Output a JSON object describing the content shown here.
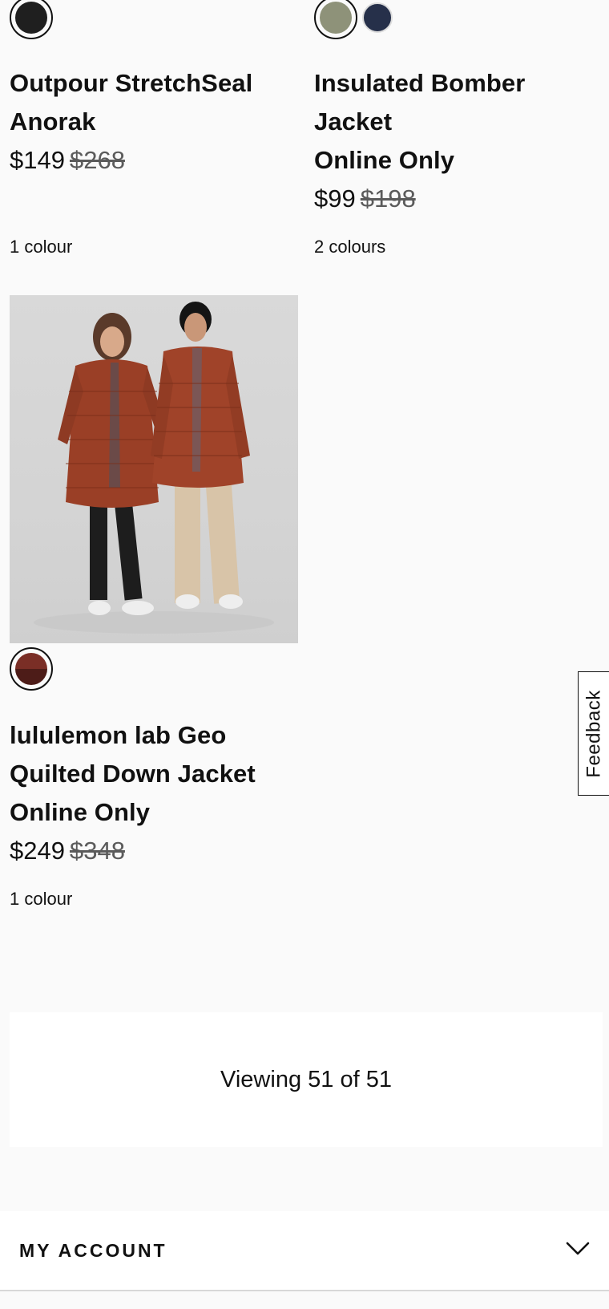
{
  "products": [
    {
      "name": "Outpour StretchSeal Anorak",
      "online_only": "",
      "price": "$149",
      "was_price": "$268",
      "colours": "1 colour",
      "swatches": [
        "#1f1f1f"
      ]
    },
    {
      "name": "Insulated Bomber Jacket",
      "online_only": "Online Only",
      "price": "$99",
      "was_price": "$198",
      "colours": "2 colours",
      "swatches": [
        "#8e9279",
        "#26304a"
      ]
    },
    {
      "name": "lululemon lab Geo Quilted Down Jacket",
      "online_only": "Online Only",
      "price": "$249",
      "was_price": "$348",
      "colours": "1 colour",
      "swatches": [
        "#5e2620"
      ]
    }
  ],
  "pagination": {
    "viewing_text": "Viewing 51 of 51"
  },
  "footer": {
    "my_account": "MY ACCOUNT"
  },
  "feedback": {
    "label": "Feedback"
  },
  "icons": {
    "account_toggle": "chevron-down-icon"
  }
}
